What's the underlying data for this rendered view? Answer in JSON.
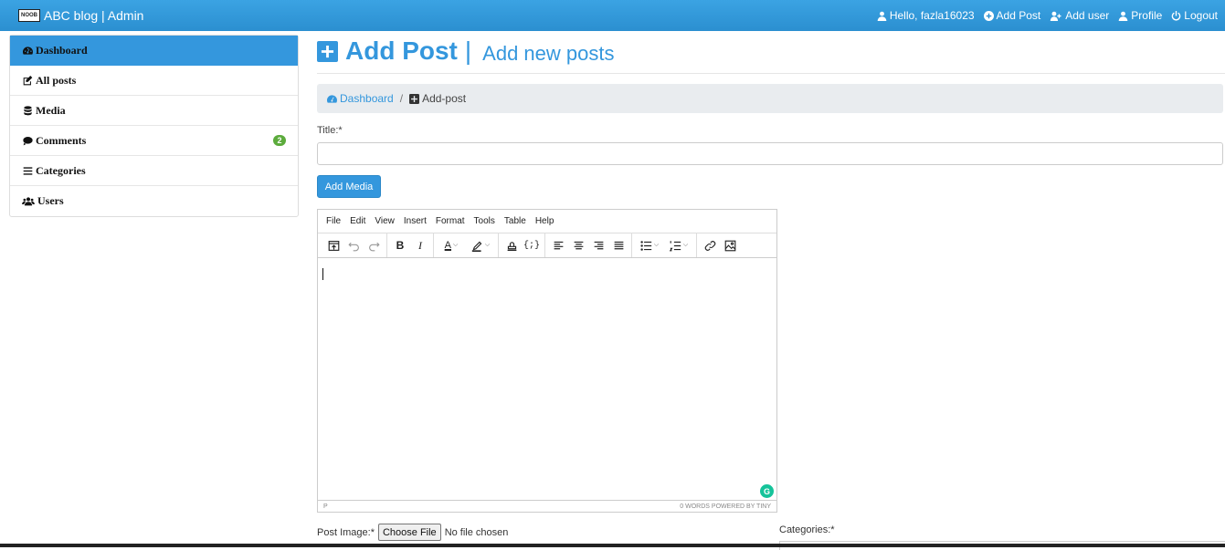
{
  "navbar": {
    "brand": "ABC blog | Admin",
    "logo_text": "NOOB",
    "greeting": "Hello, fazla16023",
    "add_post": "Add Post",
    "add_user": "Add user",
    "profile": "Profile",
    "logout": "Logout"
  },
  "sidebar": {
    "items": [
      {
        "label": "Dashboard",
        "icon": "tachometer-icon",
        "active": true
      },
      {
        "label": "All posts",
        "icon": "edit-icon"
      },
      {
        "label": "Media",
        "icon": "database-icon"
      },
      {
        "label": "Comments",
        "icon": "comment-icon",
        "badge": "2"
      },
      {
        "label": "Categories",
        "icon": "bars-icon"
      },
      {
        "label": "Users",
        "icon": "users-icon"
      }
    ]
  },
  "header": {
    "title": "Add Post",
    "separator": "|",
    "subtitle": "Add new posts"
  },
  "breadcrumb": {
    "home": "Dashboard",
    "separator": "/",
    "current": "Add-post"
  },
  "form": {
    "title_label": "Title:*",
    "title_value": "",
    "add_media": "Add Media",
    "post_image_label": "Post Image:*",
    "choose_file": "Choose File",
    "no_file": "No file chosen",
    "categories_label": "Categories:*"
  },
  "editor": {
    "menu": [
      "File",
      "Edit",
      "View",
      "Insert",
      "Format",
      "Tools",
      "Table",
      "Help"
    ],
    "status_path": "P",
    "status_right": "0 WORDS  POWERED BY TINY"
  },
  "colors": {
    "accent": "#3497dd",
    "badge": "#5cab3c"
  }
}
